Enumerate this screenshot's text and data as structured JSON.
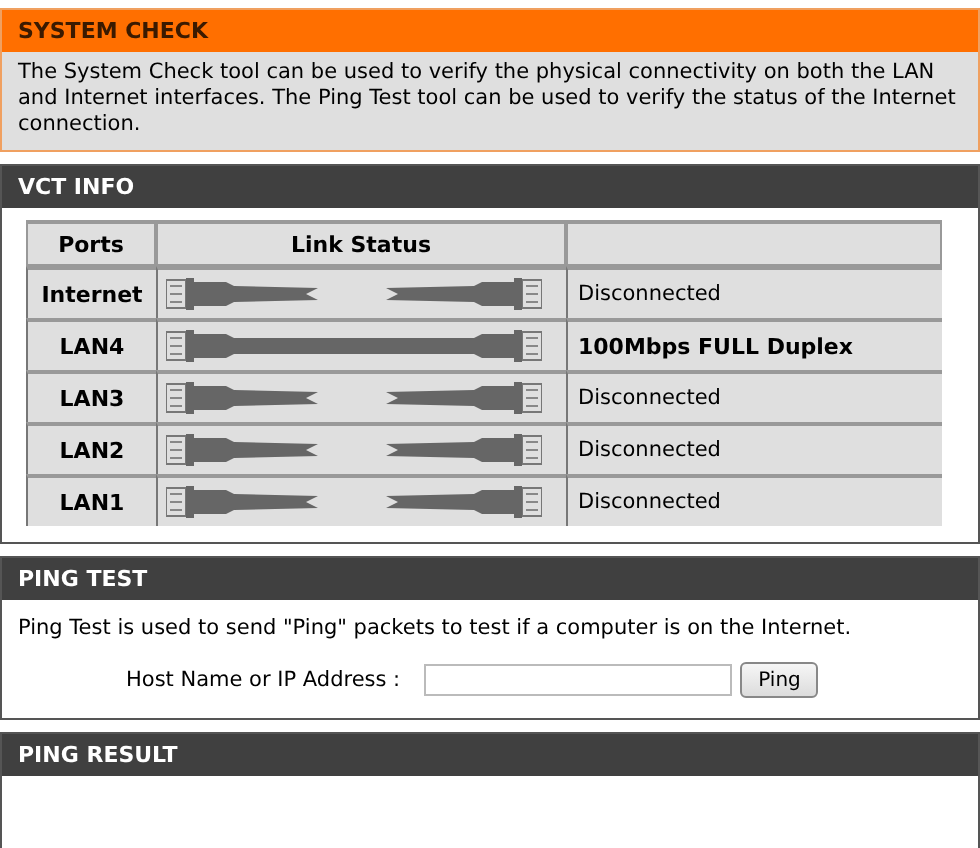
{
  "system_check": {
    "title": "SYSTEM CHECK",
    "description": "The System Check tool can be used to verify the physical connectivity on both the LAN and Internet interfaces. The Ping Test tool can be used to verify the status of the Internet connection."
  },
  "vct_info": {
    "title": "VCT INFO",
    "columns": [
      "Ports",
      "Link Status"
    ],
    "rows": [
      {
        "port": "Internet",
        "connected": false,
        "status": "Disconnected"
      },
      {
        "port": "LAN4",
        "connected": true,
        "status": "100Mbps FULL Duplex"
      },
      {
        "port": "LAN3",
        "connected": false,
        "status": "Disconnected"
      },
      {
        "port": "LAN2",
        "connected": false,
        "status": "Disconnected"
      },
      {
        "port": "LAN1",
        "connected": false,
        "status": "Disconnected"
      }
    ]
  },
  "ping_test": {
    "title": "PING TEST",
    "description": "Ping Test is used to send \"Ping\" packets to test if a computer is on the Internet.",
    "field_label": "Host Name or IP Address :",
    "button": "Ping"
  },
  "ping_result": {
    "title": "PING RESULT"
  }
}
